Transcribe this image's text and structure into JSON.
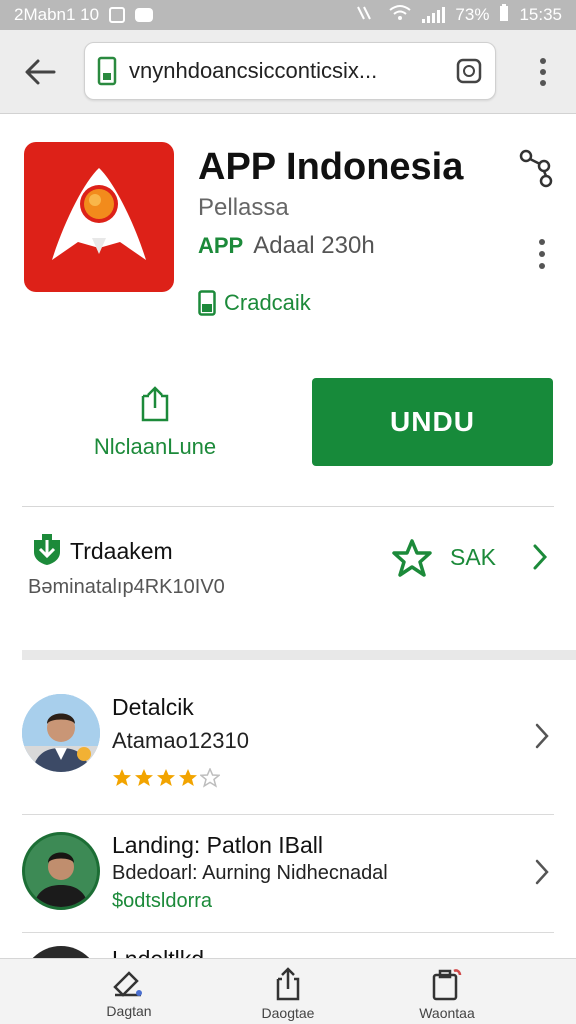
{
  "status_bar": {
    "left_text": "2Mabn1 10",
    "battery": "73%",
    "time": "15:35"
  },
  "browser": {
    "url": "vnynhdoancsicconticsix...",
    "back_icon": "back-arrow-icon",
    "menu_icon": "more-vertical-icon"
  },
  "app": {
    "title": "APP Indonesia",
    "developer": "Pellassa",
    "badge": "APP",
    "badge_text": "Adaal 230h",
    "category": "Cradcaik",
    "brand_color": "#dd2118",
    "accent_color": "#178a3a"
  },
  "actions": {
    "wishlist_label": "NlclaanLune",
    "install_label": "UNDU"
  },
  "info": {
    "title": "Trdaakem",
    "subtitle": "Bəminatalıp4RK10IV0",
    "link_label": "SAK"
  },
  "list": [
    {
      "title": "Detalcik",
      "subtitle": "Atamao12310",
      "rating": 4,
      "rating_max": 5
    },
    {
      "title": "Landing: Patlon IBall",
      "subtitle": "Bdedoarl: Aurning Nidhecnadal",
      "tag": "$odtsldorra"
    },
    {
      "title": "Lndeltlkd"
    }
  ],
  "bottom_nav": [
    {
      "label": "Dagtan",
      "icon": "edit-icon"
    },
    {
      "label": "Daogtae",
      "icon": "share-icon"
    },
    {
      "label": "Waontaa",
      "icon": "clipboard-icon"
    }
  ]
}
